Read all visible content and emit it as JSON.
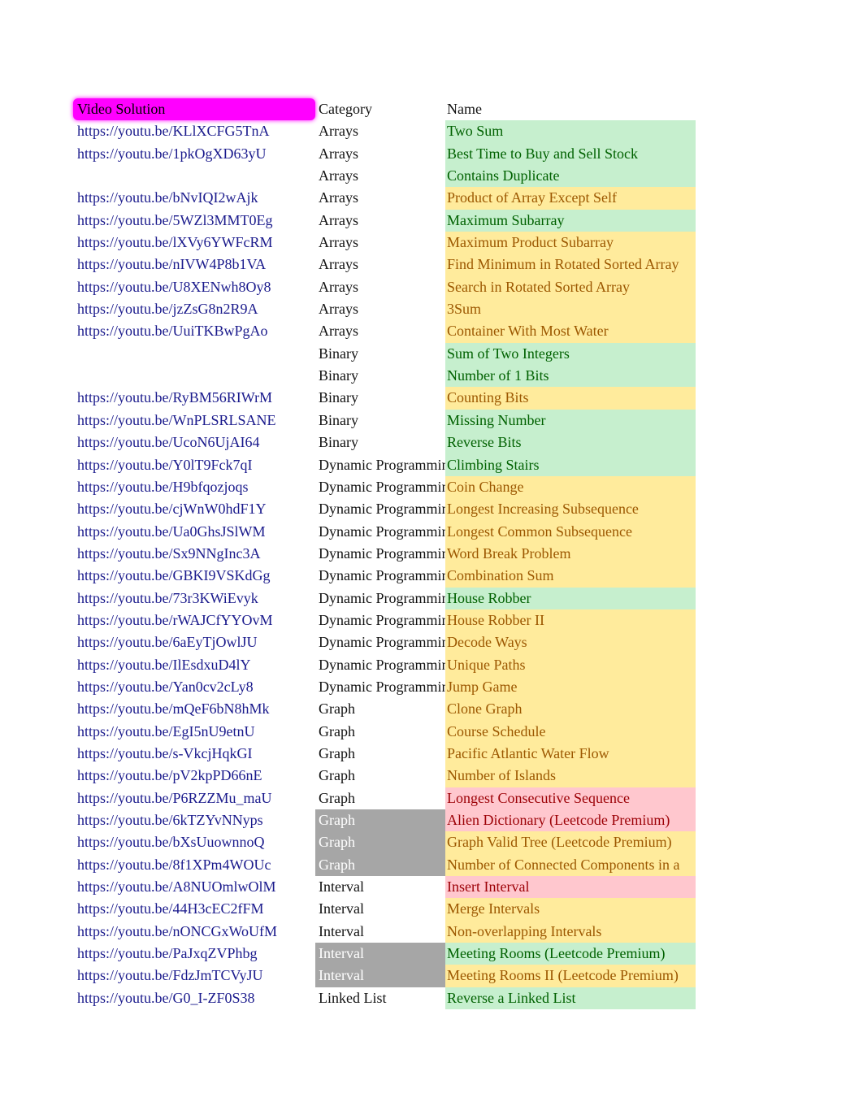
{
  "header": {
    "video": "Video Solution",
    "category": "Category",
    "name": "Name"
  },
  "colors": {
    "header_bg": "#ff00ff",
    "easy_bg": "#c6efce",
    "easy_text": "#006100",
    "medium_bg": "#ffeb9c",
    "medium_text": "#9c5700",
    "hard_bg": "#ffc7ce",
    "hard_text": "#9c0006",
    "premium_category_bg": "#a6a6a6",
    "link": "#1a1a8c"
  },
  "rows": [
    {
      "url": "https://youtu.be/KLlXCFG5TnA",
      "category": "Arrays",
      "name": "Two Sum",
      "level": "g"
    },
    {
      "url": "https://youtu.be/1pkOgXD63yU",
      "category": "Arrays",
      "name": "Best Time to Buy and Sell Stock",
      "level": "g"
    },
    {
      "url": "",
      "category": "Arrays",
      "name": "Contains Duplicate",
      "level": "g"
    },
    {
      "url": "https://youtu.be/bNvIQI2wAjk",
      "category": "Arrays",
      "name": "Product of Array Except Self",
      "level": "o"
    },
    {
      "url": "https://youtu.be/5WZl3MMT0Eg",
      "category": "Arrays",
      "name": "Maximum Subarray",
      "level": "g"
    },
    {
      "url": "https://youtu.be/lXVy6YWFcRM",
      "category": "Arrays",
      "name": "Maximum Product Subarray",
      "level": "o"
    },
    {
      "url": "https://youtu.be/nIVW4P8b1VA",
      "category": "Arrays",
      "name": "Find Minimum in Rotated Sorted Array",
      "level": "o"
    },
    {
      "url": "https://youtu.be/U8XENwh8Oy8",
      "category": "Arrays",
      "name": "Search in Rotated Sorted Array",
      "level": "o"
    },
    {
      "url": "https://youtu.be/jzZsG8n2R9A",
      "category": "Arrays",
      "name": "3Sum",
      "level": "o"
    },
    {
      "url": "https://youtu.be/UuiTKBwPgAo",
      "category": "Arrays",
      "name": "Container With Most Water",
      "level": "o"
    },
    {
      "url": "",
      "category": "Binary",
      "name": "Sum of Two Integers",
      "level": "g"
    },
    {
      "url": "",
      "category": "Binary",
      "name": "Number of 1 Bits",
      "level": "g"
    },
    {
      "url": "https://youtu.be/RyBM56RIWrM",
      "category": "Binary",
      "name": "Counting Bits",
      "level": "o"
    },
    {
      "url": "https://youtu.be/WnPLSRLSANE",
      "category": "Binary",
      "name": "Missing Number",
      "level": "g"
    },
    {
      "url": "https://youtu.be/UcoN6UjAI64",
      "category": "Binary",
      "name": "Reverse Bits",
      "level": "g"
    },
    {
      "url": "https://youtu.be/Y0lT9Fck7qI",
      "category": "Dynamic Programming",
      "name": "Climbing Stairs",
      "level": "g"
    },
    {
      "url": "https://youtu.be/H9bfqozjoqs",
      "category": "Dynamic Programming",
      "name": "Coin Change",
      "level": "o"
    },
    {
      "url": "https://youtu.be/cjWnW0hdF1Y",
      "category": "Dynamic Programming",
      "name": "Longest Increasing Subsequence",
      "level": "o"
    },
    {
      "url": "https://youtu.be/Ua0GhsJSlWM",
      "category": "Dynamic Programming",
      "name": "Longest Common Subsequence",
      "level": "o"
    },
    {
      "url": "https://youtu.be/Sx9NNgInc3A",
      "category": "Dynamic Programming",
      "name": "Word Break Problem",
      "level": "o"
    },
    {
      "url": "https://youtu.be/GBKI9VSKdGg",
      "category": "Dynamic Programming",
      "name": "Combination Sum",
      "level": "o"
    },
    {
      "url": "https://youtu.be/73r3KWiEvyk",
      "category": "Dynamic Programming",
      "name": "House Robber",
      "level": "g"
    },
    {
      "url": "https://youtu.be/rWAJCfYYOvM",
      "category": "Dynamic Programming",
      "name": "House Robber II",
      "level": "o"
    },
    {
      "url": "https://youtu.be/6aEyTjOwlJU",
      "category": "Dynamic Programming",
      "name": "Decode Ways",
      "level": "o"
    },
    {
      "url": "https://youtu.be/IlEsdxuD4lY",
      "category": "Dynamic Programming",
      "name": "Unique Paths",
      "level": "o"
    },
    {
      "url": "https://youtu.be/Yan0cv2cLy8",
      "category": "Dynamic Programming",
      "name": "Jump Game",
      "level": "o"
    },
    {
      "url": "https://youtu.be/mQeF6bN8hMk",
      "category": "Graph",
      "name": "Clone Graph",
      "level": "o"
    },
    {
      "url": "https://youtu.be/EgI5nU9etnU",
      "category": "Graph",
      "name": "Course Schedule",
      "level": "o"
    },
    {
      "url": "https://youtu.be/s-VkcjHqkGI",
      "category": "Graph",
      "name": "Pacific Atlantic Water Flow",
      "level": "o"
    },
    {
      "url": "https://youtu.be/pV2kpPD66nE",
      "category": "Graph",
      "name": "Number of Islands",
      "level": "o"
    },
    {
      "url": "https://youtu.be/P6RZZMu_maU",
      "category": "Graph",
      "name": "Longest Consecutive Sequence",
      "level": "r"
    },
    {
      "url": "https://youtu.be/6kTZYvNNyps",
      "category": "Graph",
      "name": "Alien Dictionary (Leetcode Premium)",
      "level": "r",
      "premium": true
    },
    {
      "url": "https://youtu.be/bXsUuownnoQ",
      "category": "Graph",
      "name": "Graph Valid Tree (Leetcode Premium)",
      "level": "o",
      "premium": true
    },
    {
      "url": "https://youtu.be/8f1XPm4WOUc",
      "category": "Graph",
      "name": "Number of Connected Components in a",
      "level": "o",
      "premium": true
    },
    {
      "url": "https://youtu.be/A8NUOmlwOlM",
      "category": "Interval",
      "name": "Insert Interval",
      "level": "r"
    },
    {
      "url": "https://youtu.be/44H3cEC2fFM",
      "category": "Interval",
      "name": "Merge Intervals",
      "level": "o"
    },
    {
      "url": "https://youtu.be/nONCGxWoUfM",
      "category": "Interval",
      "name": "Non-overlapping Intervals",
      "level": "o"
    },
    {
      "url": "https://youtu.be/PaJxqZVPhbg",
      "category": "Interval",
      "name": "Meeting Rooms (Leetcode Premium)",
      "level": "g",
      "premium": true
    },
    {
      "url": "https://youtu.be/FdzJmTCVyJU",
      "category": "Interval",
      "name": "Meeting Rooms II (Leetcode Premium)",
      "level": "o",
      "premium": true
    },
    {
      "url": "https://youtu.be/G0_I-ZF0S38",
      "category": "Linked List",
      "name": "Reverse a Linked List",
      "level": "g"
    }
  ]
}
